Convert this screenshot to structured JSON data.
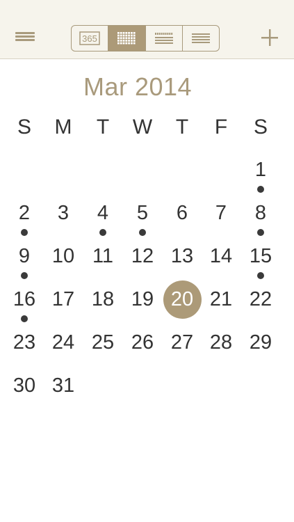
{
  "toolbar": {
    "menu_icon": "menu-icon",
    "view_modes": [
      {
        "name": "year-view",
        "icon": "year-365-icon",
        "label": "365",
        "active": false
      },
      {
        "name": "month-view",
        "icon": "month-grid-icon",
        "active": true
      },
      {
        "name": "week-view",
        "icon": "week-grid-icon",
        "active": false
      },
      {
        "name": "list-view",
        "icon": "list-icon",
        "active": false
      }
    ],
    "add_icon": "plus-icon"
  },
  "calendar": {
    "month_title": "Mar 2014",
    "weekdays": [
      "S",
      "M",
      "T",
      "W",
      "T",
      "F",
      "S"
    ],
    "weeks": [
      [
        "",
        "",
        "",
        "",
        "",
        "",
        "1"
      ],
      [
        "2",
        "3",
        "4",
        "5",
        "6",
        "7",
        "8"
      ],
      [
        "9",
        "10",
        "11",
        "12",
        "13",
        "14",
        "15"
      ],
      [
        "16",
        "17",
        "18",
        "19",
        "20",
        "21",
        "22"
      ],
      [
        "23",
        "24",
        "25",
        "26",
        "27",
        "28",
        "29"
      ],
      [
        "30",
        "31",
        "",
        "",
        "",
        "",
        ""
      ]
    ],
    "today": "20",
    "event_days": [
      "1",
      "2",
      "4",
      "5",
      "8",
      "9",
      "15",
      "16"
    ]
  },
  "colors": {
    "accent": "#ac9a78",
    "toolbar_bg": "#f6f4ec",
    "text": "#333333",
    "dot": "#3a3a3a"
  }
}
